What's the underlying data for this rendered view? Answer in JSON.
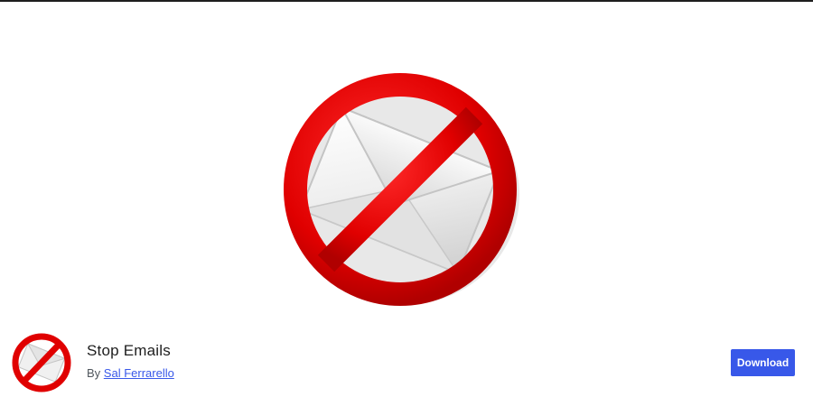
{
  "plugin": {
    "name": "Stop Emails",
    "by_prefix": "By",
    "author": "Sal Ferrarello",
    "download_label": "Download"
  },
  "banner": {
    "icon": "no-email-icon"
  },
  "colors": {
    "prohibition_red": "#e00000",
    "accent_blue": "#3858e9",
    "text_dark": "#1e1e1e",
    "text_muted": "#50575e"
  }
}
